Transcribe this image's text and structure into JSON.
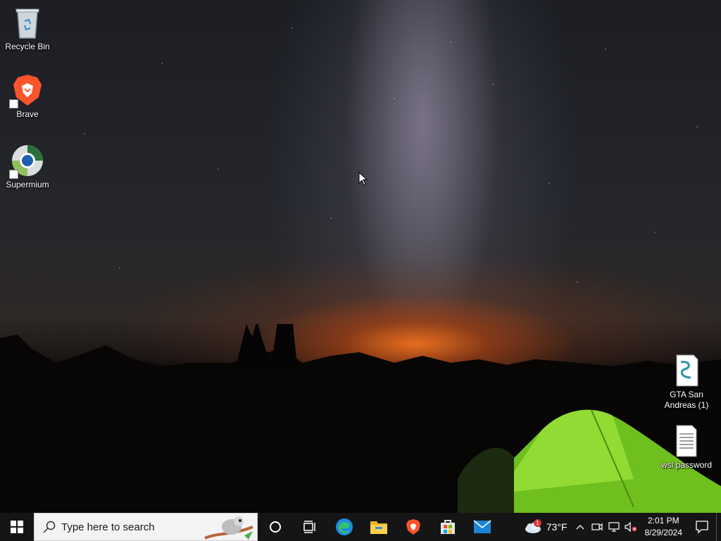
{
  "desktop_icons": {
    "recycle_bin": "Recycle Bin",
    "brave": "Brave",
    "supermium": "Supermium",
    "gta_san_andreas": "GTA San Andreas (1)",
    "wsl_password": "wsl password"
  },
  "taskbar": {
    "search_placeholder": "Type here to search",
    "apps": [
      "Cortana",
      "Task View",
      "Microsoft Edge",
      "File Explorer",
      "Brave",
      "Microsoft Store",
      "Mail"
    ],
    "weather": {
      "temperature": "73°F",
      "badge": "1",
      "icon": "partly-cloudy-icon"
    },
    "clock": {
      "time": "2:01 PM",
      "date": "8/29/2024"
    }
  },
  "colors": {
    "taskbar_bg": "#151515",
    "search_bg": "#f3f3f3",
    "tent_green": "#7ed321",
    "brave_orange": "#fb542b"
  }
}
